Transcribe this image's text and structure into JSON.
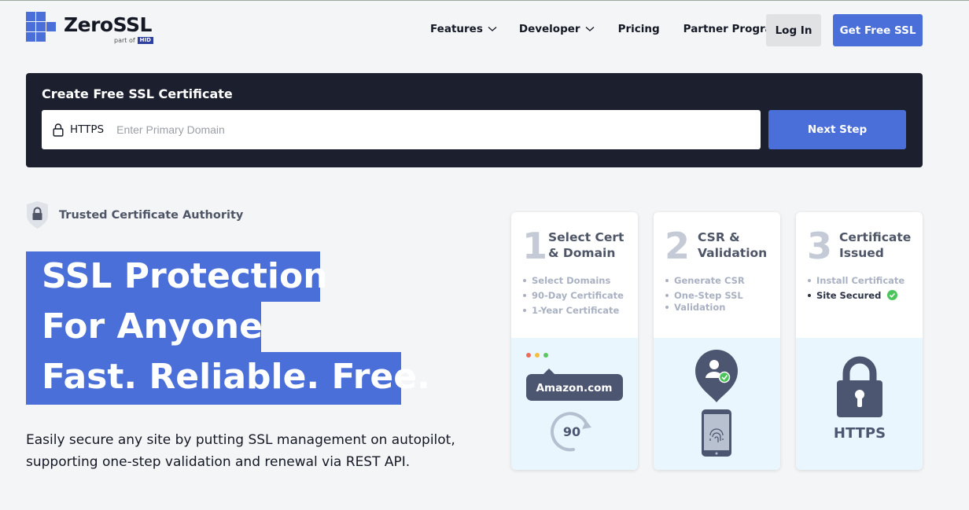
{
  "header": {
    "brand": "ZeroSSL",
    "part_of": "part of",
    "parent_badge": "HID",
    "nav": [
      {
        "label": "Features",
        "dropdown": true
      },
      {
        "label": "Developer",
        "dropdown": true
      },
      {
        "label": "Pricing",
        "dropdown": false
      },
      {
        "label": "Partner Program",
        "dropdown": false
      }
    ],
    "login_label": "Log In",
    "cta_label": "Get Free SSL"
  },
  "create": {
    "title": "Create Free SSL Certificate",
    "prefix": "HTTPS",
    "placeholder": "Enter Primary Domain",
    "value": "",
    "next_label": "Next Step"
  },
  "hero": {
    "trusted_label": "Trusted Certificate Authority",
    "headline": [
      "SSL Protection",
      "For Anyone",
      "Fast. Reliable. Free."
    ],
    "description_line1": "Easily secure any site by putting SSL management on autopilot,",
    "description_line2": "supporting one-step validation and renewal via REST API."
  },
  "steps": [
    {
      "number": "1",
      "title_line1": "Select Cert",
      "title_line2": "& Domain",
      "items": [
        "Select Domains",
        "90-Day Certificate",
        "1-Year Certificate"
      ],
      "illustration": {
        "domain_label": "Amazon.com",
        "days_label": "90"
      }
    },
    {
      "number": "2",
      "title_line1": "CSR &",
      "title_line2": "Validation",
      "items": [
        "Generate CSR",
        "One-Step SSL",
        "Validation"
      ]
    },
    {
      "number": "3",
      "title_line1": "Certificate",
      "title_line2": "Issued",
      "items": [
        "Install Certificate",
        "Site Secured"
      ],
      "illustration": {
        "https_label": "HTTPS"
      }
    }
  ],
  "colors": {
    "accent": "#4a6fd8",
    "dark_panel": "#1c1f2e",
    "page_bg": "#f4f5f6",
    "illustration": "#4d5670",
    "success": "#4bc45b"
  }
}
